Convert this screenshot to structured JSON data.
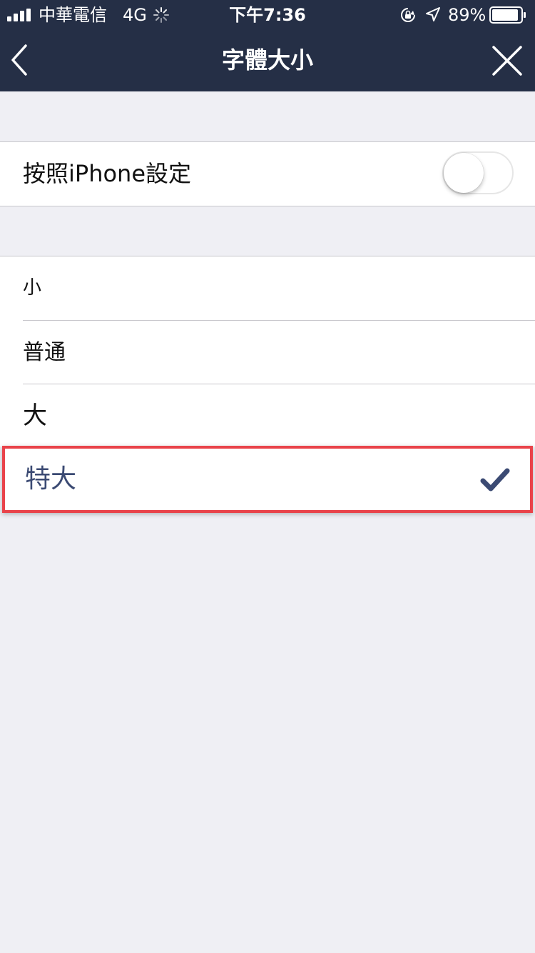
{
  "status_bar": {
    "carrier": "中華電信",
    "network": "4G",
    "time": "下午7:36",
    "battery": "89%"
  },
  "nav": {
    "title": "字體大小",
    "back_icon": "chevron-left-icon",
    "close_icon": "close-icon"
  },
  "settings": {
    "follow_iphone_label": "按照iPhone設定",
    "follow_iphone_enabled": false
  },
  "sizes": {
    "items": [
      {
        "label": "小",
        "selected": false
      },
      {
        "label": "普通",
        "selected": false
      },
      {
        "label": "大",
        "selected": false
      },
      {
        "label": "特大",
        "selected": true
      }
    ]
  },
  "colors": {
    "nav_bg": "#252f46",
    "page_bg": "#efeff4",
    "selected_text": "#3b4a73",
    "highlight_border": "#e9434a"
  }
}
